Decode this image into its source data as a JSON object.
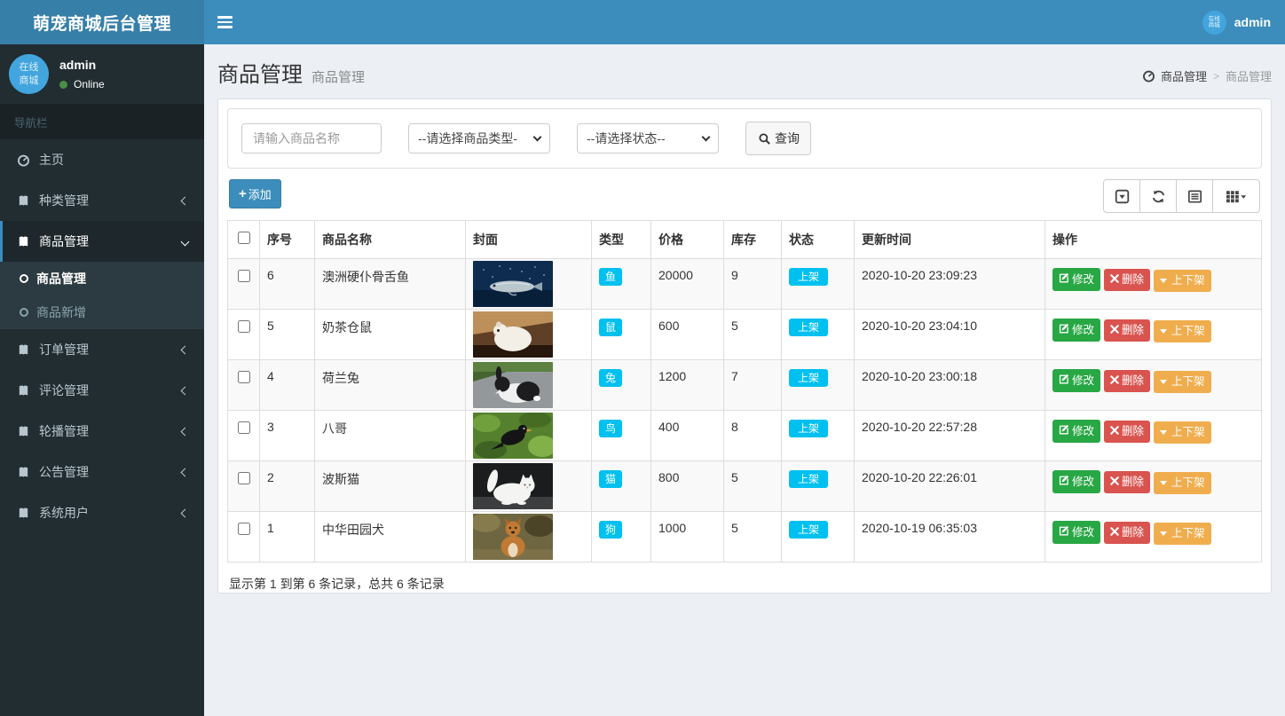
{
  "brand": "萌宠商城后台管理",
  "navbar": {
    "user_name": "admin",
    "avatar_top": "在线",
    "avatar_bottom": "商城"
  },
  "sidebar": {
    "user": {
      "name": "admin",
      "status_label": "Online",
      "avatar_top": "在线",
      "avatar_bottom": "商城"
    },
    "section_label": "导航栏",
    "items": [
      {
        "label": "主页",
        "icon": "dashboard",
        "chevron": "none",
        "active": false
      },
      {
        "label": "种类管理",
        "icon": "book",
        "chevron": "left",
        "active": false
      },
      {
        "label": "商品管理",
        "icon": "book",
        "chevron": "down",
        "active": true,
        "children": [
          {
            "label": "商品管理",
            "active": true
          },
          {
            "label": "商品新增",
            "active": false
          }
        ]
      },
      {
        "label": "订单管理",
        "icon": "book",
        "chevron": "left",
        "active": false
      },
      {
        "label": "评论管理",
        "icon": "book",
        "chevron": "left",
        "active": false
      },
      {
        "label": "轮播管理",
        "icon": "book",
        "chevron": "left",
        "active": false
      },
      {
        "label": "公告管理",
        "icon": "book",
        "chevron": "left",
        "active": false
      },
      {
        "label": "系统用户",
        "icon": "book",
        "chevron": "left",
        "active": false
      }
    ]
  },
  "page": {
    "title": "商品管理",
    "subtitle": "商品管理",
    "breadcrumb": {
      "root": "商品管理",
      "current": "商品管理"
    }
  },
  "filters": {
    "name_placeholder": "请输入商品名称",
    "type_selected": "--请选择商品类型-",
    "status_selected": "--请选择状态--",
    "search_label": "查询"
  },
  "toolbar": {
    "add_label": "添加"
  },
  "table": {
    "columns": [
      "序号",
      "商品名称",
      "封面",
      "类型",
      "价格",
      "库存",
      "状态",
      "更新时间",
      "操作"
    ],
    "action_labels": {
      "edit": "修改",
      "delete": "删除",
      "toggle": "上下架"
    },
    "rows": [
      {
        "id": "6",
        "name": "澳洲硬仆骨舌鱼",
        "cover": "arowana-fish",
        "type": "鱼",
        "price": "20000",
        "stock": "9",
        "status": "上架",
        "updated": "2020-10-20 23:09:23"
      },
      {
        "id": "5",
        "name": "奶茶仓鼠",
        "cover": "hamster",
        "type": "鼠",
        "price": "600",
        "stock": "5",
        "status": "上架",
        "updated": "2020-10-20 23:04:10"
      },
      {
        "id": "4",
        "name": "荷兰兔",
        "cover": "dutch-rabbit",
        "type": "兔",
        "price": "1200",
        "stock": "7",
        "status": "上架",
        "updated": "2020-10-20 23:00:18"
      },
      {
        "id": "3",
        "name": "八哥",
        "cover": "myna-bird",
        "type": "鸟",
        "price": "400",
        "stock": "8",
        "status": "上架",
        "updated": "2020-10-20 22:57:28"
      },
      {
        "id": "2",
        "name": "波斯猫",
        "cover": "persian-cat",
        "type": "猫",
        "price": "800",
        "stock": "5",
        "status": "上架",
        "updated": "2020-10-20 22:26:01"
      },
      {
        "id": "1",
        "name": "中华田园犬",
        "cover": "pastoral-dog",
        "type": "狗",
        "price": "1000",
        "stock": "5",
        "status": "上架",
        "updated": "2020-10-19 06:35:03"
      }
    ]
  },
  "footer": {
    "summary": "显示第 1 到第 6 条记录，总共 6 条记录"
  },
  "colors": {
    "navbar": "#3c8dbc",
    "logo_bg": "#367fa9",
    "sidebar_bg": "#222d32",
    "submenu_bg": "#2c3b41",
    "content_bg": "#ecf0f5",
    "accent": "#3c8dbc",
    "badge_cyan": "#00c0ef",
    "edit_green": "#28a745",
    "delete_red": "#d9534f",
    "toggle_orange": "#f0ad4e",
    "online_green": "#4a8e46",
    "avatar_blue": "#42a5dd"
  }
}
